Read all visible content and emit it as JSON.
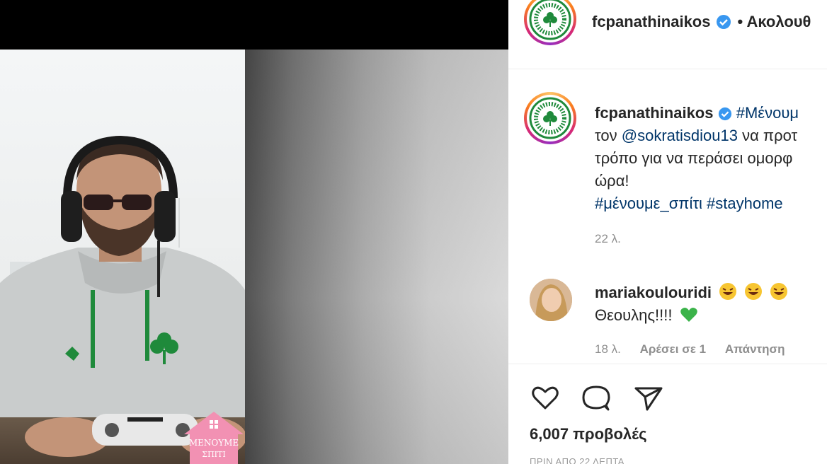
{
  "post": {
    "username": "fcpanathinaikos",
    "follow_label": "• Ακολουθ",
    "verified_icon": "verified-badge-icon"
  },
  "caption": {
    "username": "fcpanathinaikos",
    "hashtag1": "#Μένουμ",
    "line2_mention": "@sokratisdiou13",
    "line2_prefix": "τον",
    "line2_suffix": "να προτ",
    "line3": "τρόπο για να περάσει ομορφ",
    "line4": "ώρα!",
    "hashtags": "#μένουμε_σπίτι #stayhome",
    "time": "22 λ."
  },
  "comment": {
    "username": "mariakoulouridi",
    "text": "Θεουλης!!!!",
    "time": "18 λ.",
    "likes_label": "Αρέσει σε 1",
    "reply_label": "Απάντηση"
  },
  "actions": {
    "views": "6,007 προβολές",
    "date": "ΠΡΙΝ ΑΠΟ 22 ΛΕΠΤΑ",
    "icons": [
      "heart-icon",
      "comment-icon",
      "share-icon"
    ]
  },
  "sticker": {
    "text_line1": "ΜΕΝΟΥΜΕ",
    "text_line2": "ΣΠΙΤΙ"
  },
  "colors": {
    "verified": "#3897f0",
    "hashtag": "#003569",
    "muted": "#8e8e8e",
    "club_green": "#1f8a3b",
    "sticker_pink": "#f291b3"
  }
}
